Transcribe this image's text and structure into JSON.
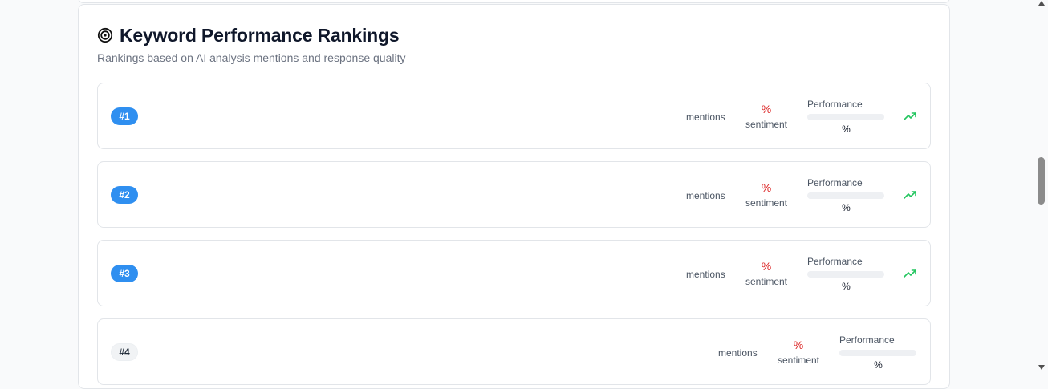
{
  "panel": {
    "title": "Keyword Performance Rankings",
    "subtitle": "Rankings based on AI analysis mentions and response quality",
    "title_icon": "target-icon"
  },
  "rankings": [
    {
      "rank": "#1",
      "mentions_label": "mentions",
      "sentiment_value": "%",
      "sentiment_label": "sentiment",
      "performance_label": "Performance",
      "performance_value": "%",
      "performance_fill": 0,
      "trend_icon": "trending-up-icon",
      "highlight": true
    },
    {
      "rank": "#2",
      "mentions_label": "mentions",
      "sentiment_value": "%",
      "sentiment_label": "sentiment",
      "performance_label": "Performance",
      "performance_value": "%",
      "performance_fill": 0,
      "trend_icon": "trending-up-icon",
      "highlight": true
    },
    {
      "rank": "#3",
      "mentions_label": "mentions",
      "sentiment_value": "%",
      "sentiment_label": "sentiment",
      "performance_label": "Performance",
      "performance_value": "%",
      "performance_fill": 0,
      "trend_icon": "trending-up-icon",
      "highlight": true
    },
    {
      "rank": "#4",
      "mentions_label": "mentions",
      "sentiment_value": "%",
      "sentiment_label": "sentiment",
      "performance_label": "Performance",
      "performance_value": "%",
      "performance_fill": 0,
      "trend_icon": "",
      "highlight": false
    }
  ],
  "colors": {
    "badge_highlight": "#2f8ff0",
    "sentiment_negative": "#dc2626",
    "trend_up": "#22c55e"
  }
}
